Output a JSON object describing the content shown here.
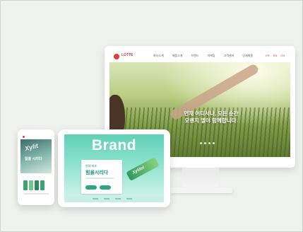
{
  "monitor": {
    "logo": "LOTTE",
    "nav": [
      "회사소개",
      "제품소개",
      "브랜드",
      "마케팅",
      "고객센터",
      "인재채용"
    ],
    "nav_right": [
      "KR",
      "EN",
      "CN"
    ],
    "hero_line1": "언제 어디서나, 모든 순간",
    "hero_line2": "오렌지 엘이 함께합니다."
  },
  "tablet": {
    "brand": "Brand",
    "card_small": "롯데 제과",
    "card_title": "힘을시리다",
    "gum_label": "Xylitol"
  },
  "phone": {
    "hero_word": "Xylit",
    "hero_text": "일을 시리다"
  },
  "colors": {
    "brand_red": "#e33c3c",
    "mint": "#5fd0b6",
    "green": "#2fa77e"
  }
}
